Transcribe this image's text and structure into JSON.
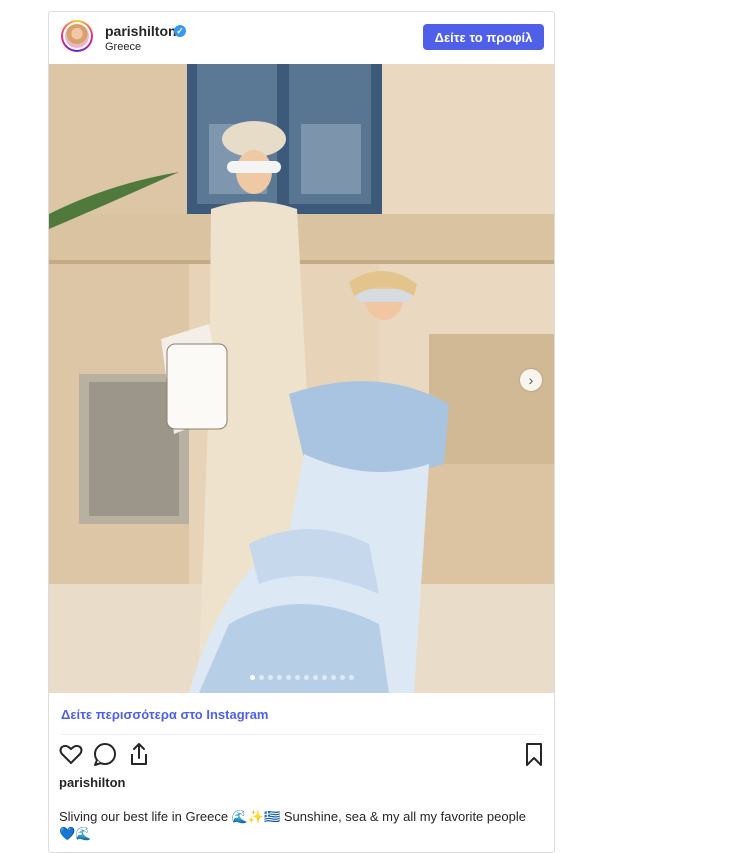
{
  "header": {
    "username": "parishilton",
    "location": "Greece",
    "profile_button": "Δείτε το προφίλ"
  },
  "post": {
    "image_alt": "Two women posing by a sunlit wall and blue door in Greece",
    "carousel": {
      "total_slides": 12,
      "active_index": 0
    }
  },
  "links": {
    "see_more": "Δείτε περισσότερα στο Instagram"
  },
  "actions": {
    "like": "heart-icon",
    "comment": "comment-icon",
    "share": "share-icon",
    "save": "bookmark-icon"
  },
  "caption": {
    "username": "parishilton",
    "text": "Sliving our best life in Greece 🌊✨🇬🇷 Sunshine, sea & my all my favorite people 💙🌊"
  },
  "colors": {
    "accent": "#4f5fe8",
    "verified": "#3897f0"
  }
}
